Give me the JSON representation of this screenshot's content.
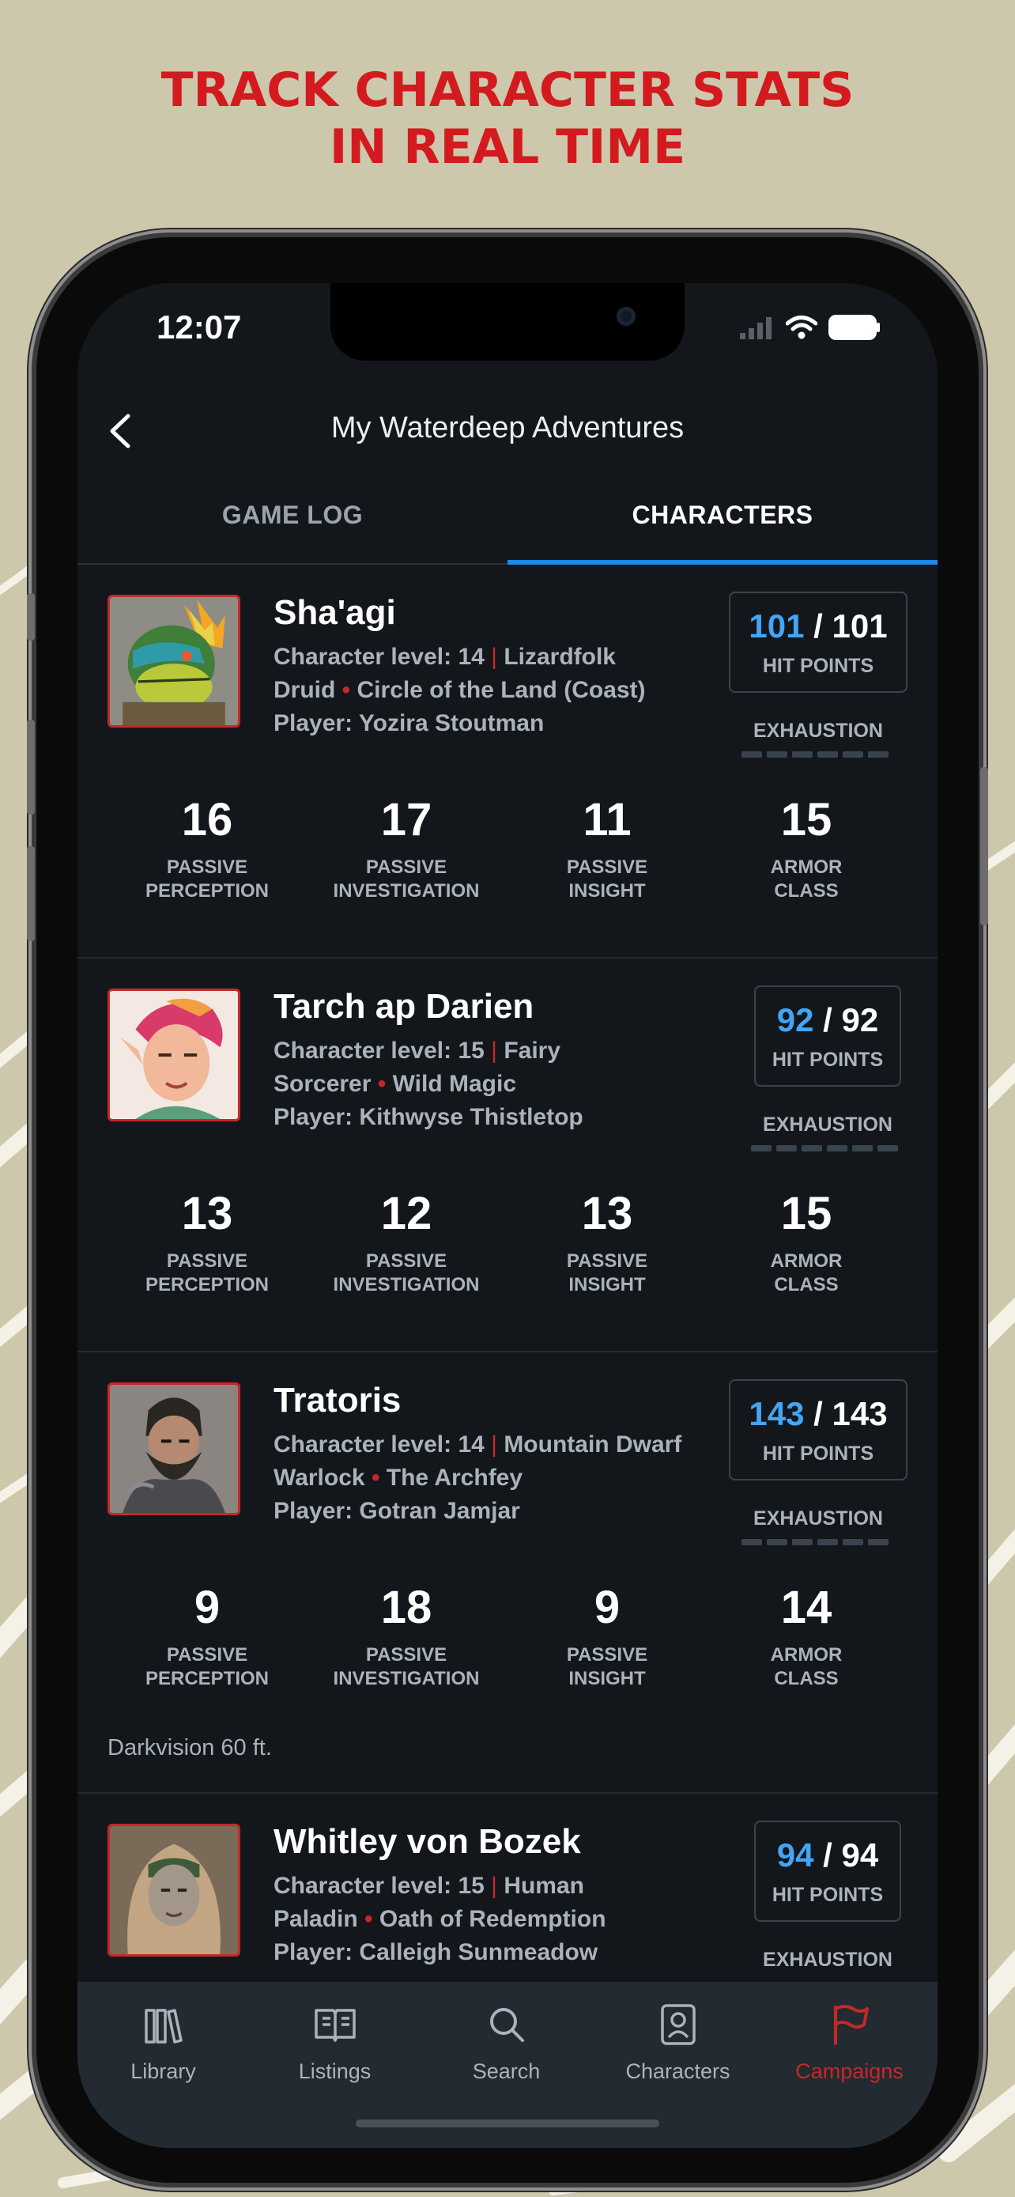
{
  "promo": {
    "line1": "TRACK CHARACTER STATS",
    "line2": "IN REAL TIME"
  },
  "status_bar": {
    "time": "12:07"
  },
  "header": {
    "title": "My Waterdeep Adventures",
    "back_icon": "chevron-left-icon"
  },
  "tabs": [
    {
      "label": "GAME LOG",
      "active": false
    },
    {
      "label": "CHARACTERS",
      "active": true
    }
  ],
  "characters": [
    {
      "name": "Sha'agi",
      "level_text": "Character level: 14",
      "race": "Lizardfolk",
      "class": "Druid",
      "subclass": "Circle of the Land (Coast)",
      "player": "Player: Yozira Stoutman",
      "hp_current": "101",
      "hp_sep": " / ",
      "hp_max": "101",
      "hp_label": "HIT POINTS",
      "exhaustion_label": "EXHAUSTION",
      "stats": [
        {
          "value": "16",
          "label1": "PASSIVE",
          "label2": "PERCEPTION"
        },
        {
          "value": "17",
          "label1": "PASSIVE",
          "label2": "INVESTIGATION"
        },
        {
          "value": "11",
          "label1": "PASSIVE",
          "label2": "INSIGHT"
        },
        {
          "value": "15",
          "label1": "ARMOR",
          "label2": "CLASS"
        }
      ]
    },
    {
      "name": "Tarch ap Darien",
      "level_text": "Character level: 15",
      "race": "Fairy",
      "class": "Sorcerer",
      "subclass": "Wild Magic",
      "player": "Player: Kithwyse Thistletop",
      "hp_current": "92",
      "hp_sep": " / ",
      "hp_max": "92",
      "hp_label": "HIT POINTS",
      "exhaustion_label": "EXHAUSTION",
      "stats": [
        {
          "value": "13",
          "label1": "PASSIVE",
          "label2": "PERCEPTION"
        },
        {
          "value": "12",
          "label1": "PASSIVE",
          "label2": "INVESTIGATION"
        },
        {
          "value": "13",
          "label1": "PASSIVE",
          "label2": "INSIGHT"
        },
        {
          "value": "15",
          "label1": "ARMOR",
          "label2": "CLASS"
        }
      ]
    },
    {
      "name": "Tratoris",
      "level_text": "Character level: 14",
      "race": "Mountain Dwarf",
      "class": "Warlock",
      "subclass": "The Archfey",
      "player": "Player: Gotran Jamjar",
      "hp_current": "143",
      "hp_sep": " / ",
      "hp_max": "143",
      "hp_label": "HIT POINTS",
      "exhaustion_label": "EXHAUSTION",
      "stats": [
        {
          "value": "9",
          "label1": "PASSIVE",
          "label2": "PERCEPTION"
        },
        {
          "value": "18",
          "label1": "PASSIVE",
          "label2": "INVESTIGATION"
        },
        {
          "value": "9",
          "label1": "PASSIVE",
          "label2": "INSIGHT"
        },
        {
          "value": "14",
          "label1": "ARMOR",
          "label2": "CLASS"
        }
      ],
      "note": "Darkvision 60 ft."
    },
    {
      "name": "Whitley von Bozek",
      "level_text": "Character level: 15",
      "race": "Human",
      "class": "Paladin",
      "subclass": "Oath of Redemption",
      "player": "Player: Calleigh Sunmeadow",
      "hp_current": "94",
      "hp_sep": " / ",
      "hp_max": "94",
      "hp_label": "HIT POINTS",
      "exhaustion_label": "EXHAUSTION"
    }
  ],
  "bottom_nav": [
    {
      "label": "Library",
      "icon": "books-icon",
      "active": false
    },
    {
      "label": "Listings",
      "icon": "open-book-icon",
      "active": false
    },
    {
      "label": "Search",
      "icon": "search-icon",
      "active": false
    },
    {
      "label": "Characters",
      "icon": "character-badge-icon",
      "active": false
    },
    {
      "label": "Campaigns",
      "icon": "flag-icon",
      "active": true
    }
  ],
  "colors": {
    "background": "#cdc7ab",
    "headline": "#d31a1f",
    "screen": "#13171b",
    "accent_blue": "#42a5f5",
    "accent_red": "#c62828"
  }
}
